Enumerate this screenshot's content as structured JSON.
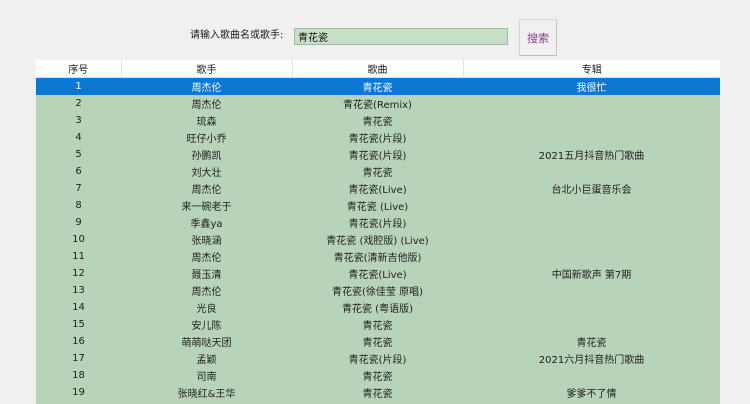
{
  "search": {
    "label": "请输入歌曲名或歌手:",
    "value": "青花瓷",
    "button_label": "搜索"
  },
  "table": {
    "headers": [
      "序号",
      "歌手",
      "歌曲",
      "专辑"
    ],
    "selected_index": 0,
    "rows": [
      [
        "1",
        "周杰伦",
        "青花瓷",
        "我很忙"
      ],
      [
        "2",
        "周杰伦",
        "青花瓷(Remix)",
        ""
      ],
      [
        "3",
        "琉森",
        "青花瓷",
        ""
      ],
      [
        "4",
        "旺仔小乔",
        "青花瓷(片段)",
        ""
      ],
      [
        "5",
        "孙鹏凯",
        "青花瓷(片段)",
        "2021五月抖音热门歌曲"
      ],
      [
        "6",
        "刘大壮",
        "青花瓷",
        ""
      ],
      [
        "7",
        "周杰伦",
        "青花瓷(Live)",
        "台北小巨蛋音乐会"
      ],
      [
        "8",
        "来一碗老于",
        "青花瓷 (Live)",
        ""
      ],
      [
        "9",
        "季鑫ya",
        "青花瓷(片段)",
        ""
      ],
      [
        "10",
        "张晓涵",
        "青花瓷 (戏腔版) (Live)",
        ""
      ],
      [
        "11",
        "周杰伦",
        "青花瓷(清新吉他版)",
        ""
      ],
      [
        "12",
        "聂玉清",
        "青花瓷(Live)",
        "中国新歌声 第7期"
      ],
      [
        "13",
        "周杰伦",
        "青花瓷(徐佳莹 原唱)",
        ""
      ],
      [
        "14",
        "光良",
        "青花瓷 (粤语版)",
        ""
      ],
      [
        "15",
        "安儿陈",
        "青花瓷",
        ""
      ],
      [
        "16",
        "萌萌哒天团",
        "青花瓷",
        "青花瓷"
      ],
      [
        "17",
        "孟颖",
        "青花瓷(片段)",
        "2021六月抖音热门歌曲"
      ],
      [
        "18",
        "司南",
        "青花瓷",
        ""
      ],
      [
        "19",
        "张晓红&王华",
        "青花瓷",
        "爹爹不了情"
      ]
    ]
  }
}
